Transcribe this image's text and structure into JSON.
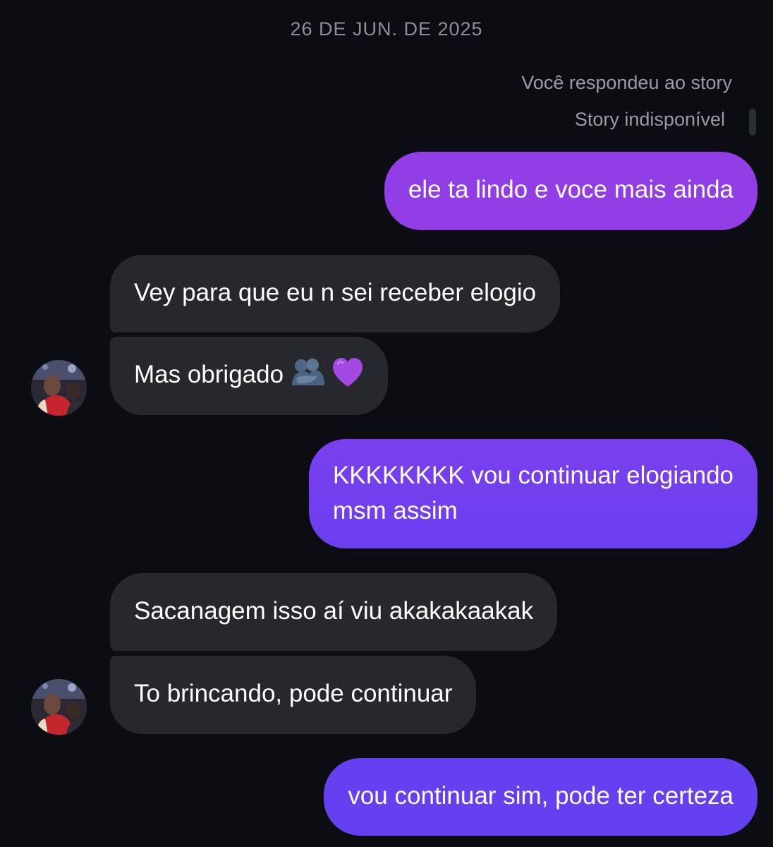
{
  "date_separator": "26 DE JUN. DE 2025",
  "story": {
    "reply_note": "Você respondeu ao story",
    "unavailable": "Story indisponível"
  },
  "messages": [
    {
      "from": "me",
      "text": "ele ta lindo e voce mais ainda"
    },
    {
      "from": "them",
      "text": "Vey para que eu n sei receber elogio"
    },
    {
      "from": "them",
      "text": "Mas obrigado",
      "emojis": [
        "people-hugging-icon",
        "purple-heart-icon"
      ]
    },
    {
      "from": "me",
      "line1": "KKKKKKKK vou continuar elogiando",
      "line2": "msm assim"
    },
    {
      "from": "them",
      "text": "Sacanagem isso aí viu akakakaakak"
    },
    {
      "from": "them",
      "text": "To brincando, pode continuar"
    },
    {
      "from": "me",
      "text": "vou continuar sim, pode ter certeza"
    }
  ],
  "colors": {
    "background": "#0c0d12",
    "incoming_bubble": "#26282e",
    "outgoing_gradient_top": "#9b3ee3",
    "outgoing_gradient_bottom": "#6a3ff0",
    "meta_text": "#9a9ca3"
  }
}
